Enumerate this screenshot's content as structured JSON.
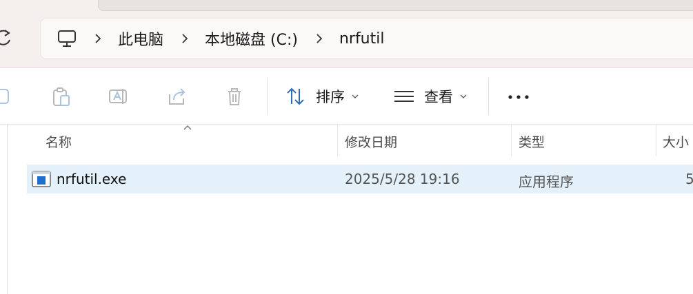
{
  "breadcrumb": {
    "root_icon": "computer-icon",
    "items": [
      "此电脑",
      "本地磁盘 (C:)",
      "nrfutil"
    ]
  },
  "toolbar": {
    "sort_label": "排序",
    "view_label": "查看",
    "icons": [
      "copy-icon",
      "paste-icon",
      "rename-icon",
      "share-icon",
      "delete-icon",
      "sort-icon",
      "view-icon",
      "more-icon"
    ]
  },
  "columns": {
    "name": "名称",
    "date_modified": "修改日期",
    "type": "类型",
    "size": "大小"
  },
  "files": [
    {
      "name": "nrfutil.exe",
      "date_modified": "2025/5/28 19:16",
      "type": "应用程序",
      "size": "5"
    }
  ],
  "colors": {
    "titlebar_bg": "#f5efee",
    "selected_row_bg": "#e4f1fb",
    "sort_icon_accent": "#2c6fb7"
  }
}
